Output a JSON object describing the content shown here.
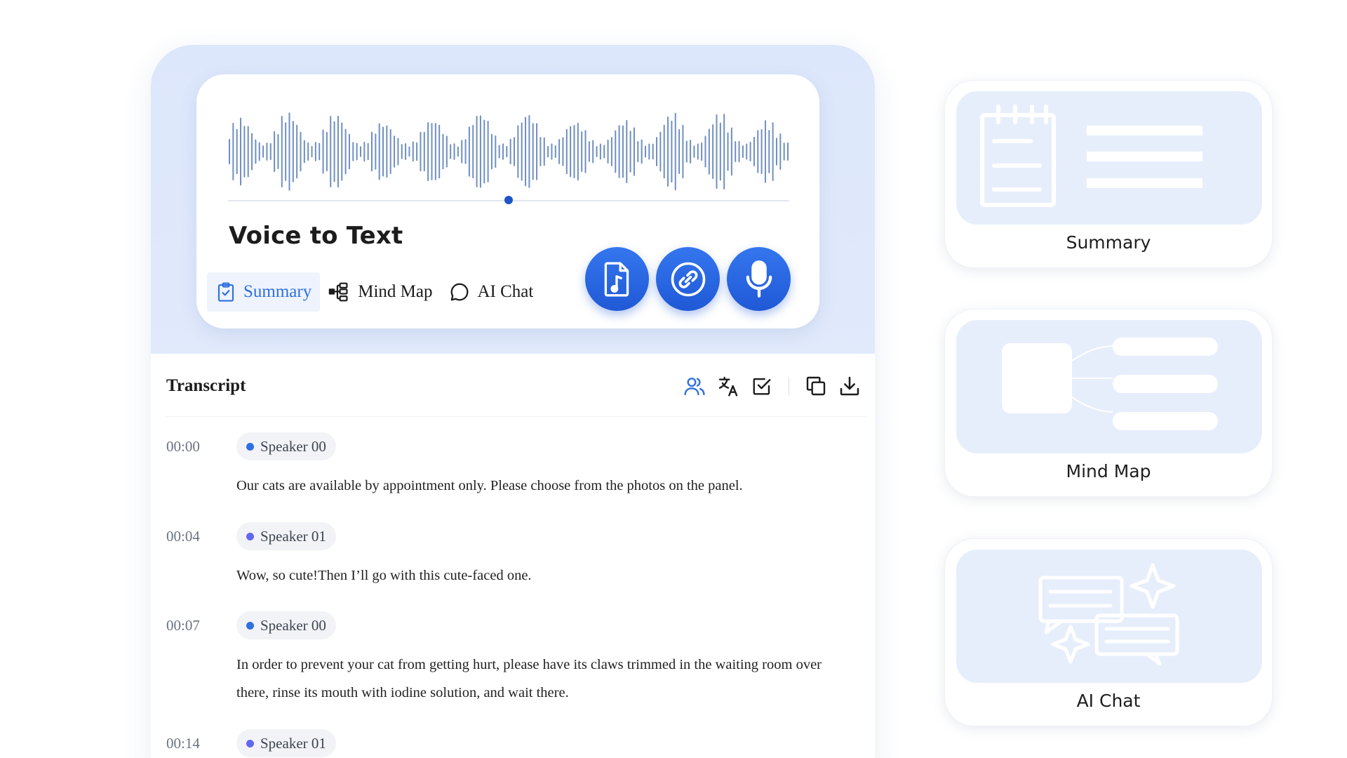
{
  "player": {
    "title": "Voice to Text",
    "progress": 0.5,
    "tabs": [
      {
        "label": "Summary",
        "icon": "clipboard-check-icon",
        "active": true
      },
      {
        "label": "Mind Map",
        "icon": "mind-map-icon",
        "active": false
      },
      {
        "label": "AI Chat",
        "icon": "chat-bubble-icon",
        "active": false
      }
    ],
    "actions": [
      "music-file-icon",
      "link-icon",
      "microphone-icon"
    ]
  },
  "transcript": {
    "title": "Transcript",
    "tools": [
      "speakers-icon",
      "translate-icon",
      "checkbox-icon",
      "copy-icon",
      "download-icon"
    ],
    "entries": [
      {
        "time": "00:00",
        "speaker": "Speaker 00",
        "color": "#2f6fe0",
        "text": "Our cats are available by appointment only. Please choose from the photos on the panel."
      },
      {
        "time": "00:04",
        "speaker": "Speaker 01",
        "color": "#6366f1",
        "text": "Wow, so cute!Then I’ll go with this cute-faced one."
      },
      {
        "time": "00:07",
        "speaker": "Speaker 00",
        "color": "#2f6fe0",
        "text": "In order to prevent your cat from getting hurt, please have its claws trimmed in the waiting room over there, rinse its mouth with iodine solution, and wait there."
      },
      {
        "time": "00:14",
        "speaker": "Speaker 01",
        "color": "#6366f1",
        "text": ""
      }
    ]
  },
  "features": [
    {
      "label": "Summary",
      "icon": "notepad-icon"
    },
    {
      "label": "Mind Map",
      "icon": "mind-map-illustration-icon"
    },
    {
      "label": "AI Chat",
      "icon": "chat-sparkle-icon"
    }
  ],
  "colors": {
    "accent": "#2f6fe0",
    "button": "#2059d6",
    "panel_bg": "#e7eefb"
  }
}
